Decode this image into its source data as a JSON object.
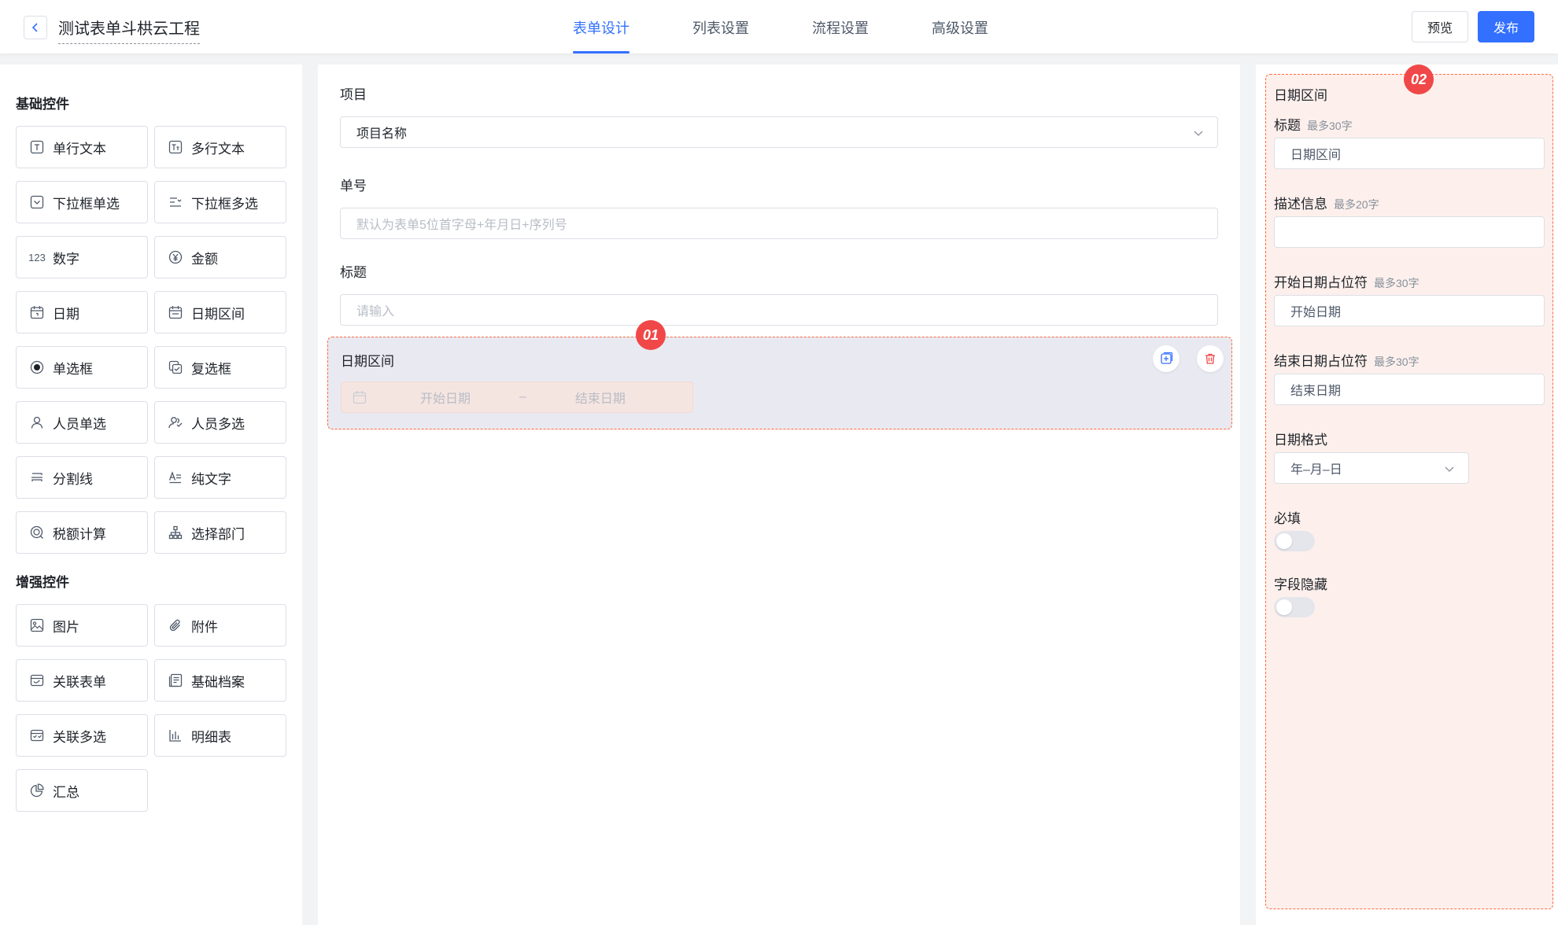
{
  "header": {
    "title": "测试表单斗栱云工程",
    "tabs": [
      "表单设计",
      "列表设置",
      "流程设置",
      "高级设置"
    ],
    "preview_label": "预览",
    "publish_label": "发布"
  },
  "left": {
    "basic_title": "基础控件",
    "basic": [
      "单行文本",
      "多行文本",
      "下拉框单选",
      "下拉框多选",
      "数字",
      "金额",
      "日期",
      "日期区间",
      "单选框",
      "复选框",
      "人员单选",
      "人员多选",
      "分割线",
      "纯文字",
      "税额计算",
      "选择部门"
    ],
    "enhanced_title": "增强控件",
    "enhanced": [
      "图片",
      "附件",
      "关联表单",
      "基础档案",
      "关联多选",
      "明细表",
      "汇总"
    ],
    "number_icon_text": "123"
  },
  "canvas": {
    "project_label": "项目",
    "project_value": "项目名称",
    "number_label": "单号",
    "number_placeholder": "默认为表单5位首字母+年月日+序列号",
    "title_label": "标题",
    "title_placeholder": "请输入",
    "date_block_label": "日期区间",
    "start_date": "开始日期",
    "separator": "–",
    "end_date": "结束日期",
    "marker": "01"
  },
  "props": {
    "marker": "02",
    "heading": "日期区间",
    "title_label": "标题",
    "title_hint": "最多30字",
    "title_value": "日期区间",
    "desc_label": "描述信息",
    "desc_hint": "最多20字",
    "desc_value": "",
    "start_label": "开始日期占位符",
    "start_hint": "最多30字",
    "start_value": "开始日期",
    "end_label": "结束日期占位符",
    "end_hint": "最多30字",
    "end_value": "结束日期",
    "format_label": "日期格式",
    "format_value": "年–月–日",
    "required_label": "必填",
    "required_on": false,
    "hidden_label": "字段隐藏",
    "hidden_on": false
  },
  "colors": {
    "accent": "#3370ff",
    "marker": "#f04848",
    "selection": "#ff6a3d"
  }
}
